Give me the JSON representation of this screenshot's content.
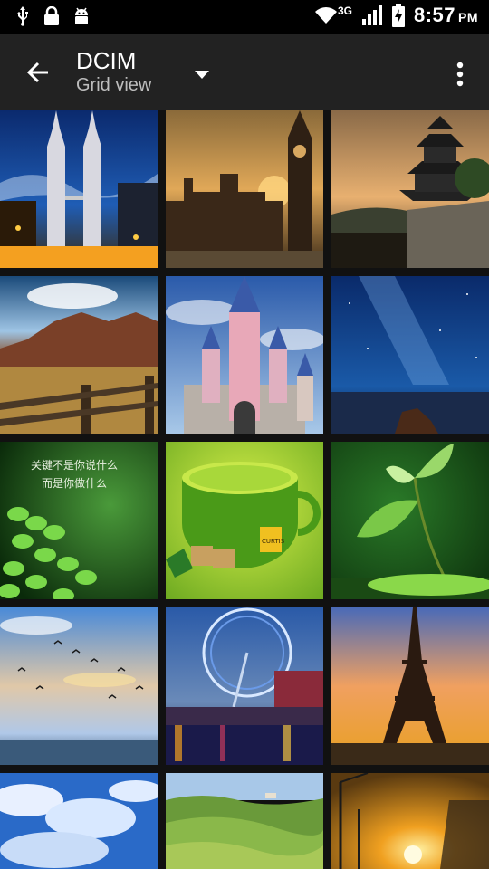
{
  "status_bar": {
    "time": "8:57",
    "ampm": "PM",
    "network": "3G",
    "icons": [
      "usb-icon",
      "lock-icon",
      "android-icon",
      "wifi-icon",
      "signal-icon",
      "battery-charging-icon"
    ]
  },
  "app_bar": {
    "title": "DCIM",
    "subtitle": "Grid view",
    "icons": [
      "back-arrow-icon",
      "dropdown-arrow-icon",
      "overflow-menu-icon"
    ]
  },
  "photos": [
    {
      "name": "photo-petronas-towers-night"
    },
    {
      "name": "photo-big-ben-sunset"
    },
    {
      "name": "photo-japanese-castle"
    },
    {
      "name": "photo-mountain-valley-fence"
    },
    {
      "name": "photo-fairy-tale-castle"
    },
    {
      "name": "photo-milky-way-sea"
    },
    {
      "name": "photo-green-leaves-quote",
      "caption_line1": "关键不是你说什么",
      "caption_line2": "而是你做什么"
    },
    {
      "name": "photo-lime-cup-tea",
      "label": "CURTIS"
    },
    {
      "name": "photo-green-sprout"
    },
    {
      "name": "photo-birds-sky-sea"
    },
    {
      "name": "photo-london-eye-night"
    },
    {
      "name": "photo-eiffel-tower-sunset"
    },
    {
      "name": "photo-blue-sky-clouds"
    },
    {
      "name": "photo-green-hills"
    },
    {
      "name": "photo-sunset-street"
    }
  ]
}
